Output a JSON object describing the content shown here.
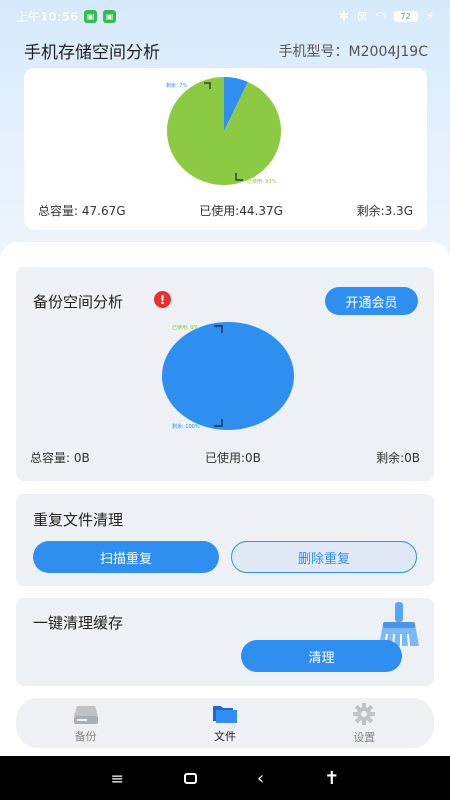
{
  "status_bar": {
    "time": "上午10:56",
    "battery": "72",
    "colors": {
      "app_icon": "#2fbf4e"
    }
  },
  "header": {
    "title": "手机存储空间分析",
    "model": "手机型号：M2004J19C"
  },
  "storage_chart": {
    "chart_data": {
      "type": "pie",
      "slices": [
        {
          "name": "剩余",
          "label": "剩余: 7%",
          "value": 6.9,
          "color": "#2e8ff0"
        },
        {
          "name": "已使用",
          "label": "已使用: 93%",
          "value": 93.1,
          "color": "#8dca44"
        }
      ]
    },
    "total": "总容量: 47.67G",
    "used": "已使用:44.37G",
    "free": "剩余:3.3G"
  },
  "backup": {
    "title": "备份空间分析",
    "warn_symbol": "!",
    "vip_button": "开通会员",
    "chart_data": {
      "type": "pie",
      "slices": [
        {
          "name": "已使用",
          "label": "已使用: 0%",
          "value": 0,
          "color": "#8dca44"
        },
        {
          "name": "剩余",
          "label": "剩余: 100%",
          "value": 100,
          "color": "#2e8ff0"
        }
      ]
    },
    "total": "总容量: 0B",
    "used": "已使用:0B",
    "free": "剩余:0B"
  },
  "duplicates": {
    "title": "重复文件清理",
    "scan_button": "扫描重复",
    "delete_button": "删除重复"
  },
  "cache": {
    "title": "一键清理缓存",
    "clean_button": "清理"
  },
  "nav": {
    "items": [
      {
        "label": "备份",
        "icon": "drive-icon",
        "active": false
      },
      {
        "label": "文件",
        "icon": "folder-icon",
        "active": true
      },
      {
        "label": "设置",
        "icon": "gear-icon",
        "active": false
      }
    ]
  },
  "colors": {
    "accent": "#2e8ff0",
    "used": "#8dca44",
    "warn": "#e5302f"
  }
}
